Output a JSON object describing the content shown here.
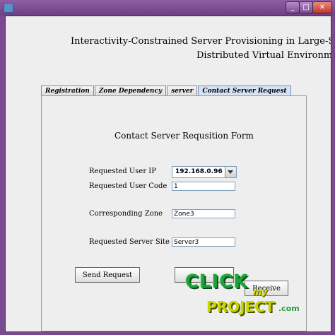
{
  "window": {
    "minimize": "_",
    "maximize": "□",
    "close": "✕"
  },
  "app": {
    "title_line1": "Interactivity-Constrained Server Provisioning in Large-Scale",
    "title_line2": "Distributed Virtual Environments"
  },
  "tabs": [
    {
      "label": "Registration",
      "active": false
    },
    {
      "label": "Zone Dependency",
      "active": false
    },
    {
      "label": "server",
      "active": false
    },
    {
      "label": "Contact Server Request",
      "active": true
    }
  ],
  "form": {
    "title": "Contact Server Requsition Form",
    "requested_user_ip": {
      "label": "Requested User IP",
      "value": "192.168.0.96"
    },
    "requested_user_code": {
      "label": "Requested User Code",
      "value": "1"
    },
    "corresponding_zone": {
      "label": "Corresponding Zone",
      "value": "Zone3"
    },
    "requested_server_site": {
      "label": "Requested Server Site",
      "value": "Server3"
    }
  },
  "buttons": {
    "send_request": "Send Request",
    "receive": "Receive"
  },
  "watermark": {
    "line1": "CLICK",
    "line2": "my",
    "line3": "PROJECT",
    "suffix": ".com"
  },
  "colors": {
    "window_frame": "#7a4a8e",
    "close_button": "#c1392b",
    "active_tab": "#d7e3f3"
  }
}
